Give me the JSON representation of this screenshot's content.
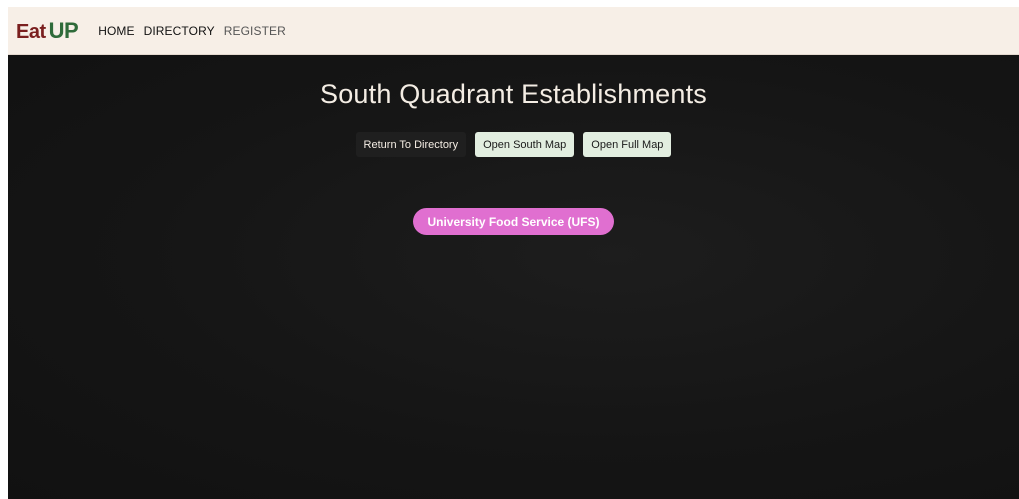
{
  "navbar": {
    "brand_eat": "Eat",
    "brand_up": "UP",
    "links": [
      "HOME",
      "DIRECTORY",
      "REGISTER"
    ]
  },
  "main": {
    "title": "South Quadrant Establishments",
    "buttons": {
      "return": "Return To Directory",
      "south_map": "Open South Map",
      "full_map": "Open Full Map"
    },
    "establishments": [
      "University Food Service (UFS)"
    ]
  },
  "colors": {
    "nav_bg": "#f7efe7",
    "brand_red": "#7a1f1f",
    "brand_green": "#2f6b3a",
    "page_bg": "#151515",
    "pill_pink": "#e06fd0",
    "light_button": "#e2eee0"
  }
}
